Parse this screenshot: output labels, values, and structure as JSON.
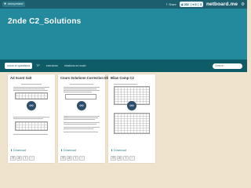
{
  "topbar": {
    "user_label": "anonymized",
    "share_label": "Share",
    "counter_views": "202",
    "counter_likes": "0",
    "counter_more": "3",
    "brand": "netboard.me"
  },
  "header": {
    "title": "2nde C2_Solutions"
  },
  "nav": {
    "tabs": [
      {
        "label": "cours et questions"
      },
      {
        "label": "TP"
      },
      {
        "label": "exercices"
      },
      {
        "label": "relations en ecart"
      }
    ],
    "search_placeholder": "Search"
  },
  "cards": [
    {
      "title": "Ad Scont Salt",
      "download": "Download"
    },
    {
      "title": "Cours Solutions-Correction Elèves",
      "download": "Download"
    },
    {
      "title": "Bilan Comp C2",
      "download": "Download"
    }
  ],
  "colors": {
    "topbar": "#1d5e6e",
    "header": "#23899c",
    "nav": "#0f5c69",
    "background": "#efe3cd",
    "badge": "#2e4d6b"
  },
  "icons": {
    "user": "user-icon",
    "share": "share-icon",
    "eye": "eye-icon",
    "heart": "heart-icon",
    "settings": "gear-icon",
    "download": "download-icon",
    "preview": "link-icon"
  }
}
